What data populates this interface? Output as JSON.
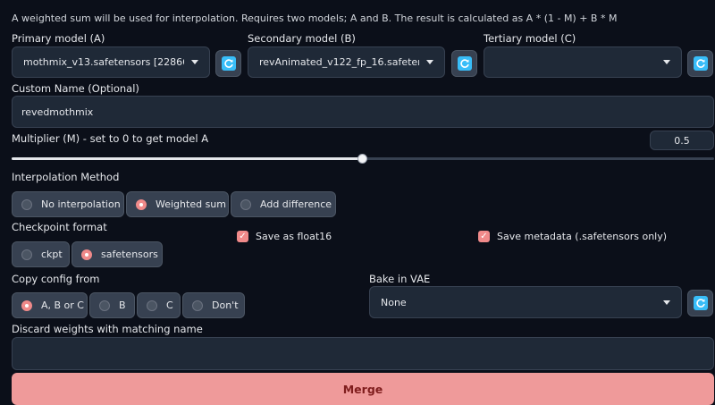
{
  "description": "A weighted sum will be used for interpolation. Requires two models; A and B. The result is calculated as A * (1 - M) + B * M",
  "models": {
    "primary": {
      "label": "Primary model (A)",
      "value": "mothmix_v13.safetensors [228663"
    },
    "secondary": {
      "label": "Secondary model (B)",
      "value": "revAnimated_v122_fp_16.safeten"
    },
    "tertiary": {
      "label": "Tertiary model (C)",
      "value": ""
    }
  },
  "custom_name": {
    "label": "Custom Name (Optional)",
    "value": "revedmothmix"
  },
  "multiplier": {
    "label": "Multiplier (M) - set to 0 to get model A",
    "value": "0.5",
    "fraction": 0.5
  },
  "interpolation": {
    "label": "Interpolation Method",
    "options": [
      "No interpolation",
      "Weighted sum",
      "Add difference"
    ],
    "selected": "Weighted sum"
  },
  "checkpoint": {
    "label": "Checkpoint format",
    "options": [
      "ckpt",
      "safetensors"
    ],
    "selected": "safetensors"
  },
  "save_float16": {
    "label": "Save as float16",
    "checked": true
  },
  "save_metadata": {
    "label": "Save metadata (.safetensors only)",
    "checked": true
  },
  "copy_config": {
    "label": "Copy config from",
    "options": [
      "A, B or C",
      "B",
      "C",
      "Don't"
    ],
    "selected": "A, B or C"
  },
  "bake_vae": {
    "label": "Bake in VAE",
    "value": "None"
  },
  "discard": {
    "label": "Discard weights with matching name",
    "value": ""
  },
  "merge_label": "Merge",
  "colors": {
    "accent": "#f08a8a",
    "merge_bg": "#ef9a9a",
    "refresh_icon": "#38bdf8",
    "background": "#0b0f19"
  }
}
